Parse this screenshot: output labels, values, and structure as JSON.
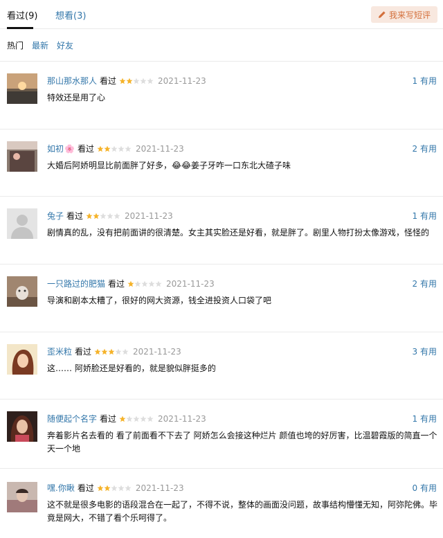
{
  "tabs": [
    {
      "label": "看过(9)",
      "active": true
    },
    {
      "label": "想看(3)",
      "active": false
    }
  ],
  "write_button": {
    "label": "我来写短评",
    "icon": "pencil-icon"
  },
  "filters": [
    {
      "label": "热门",
      "active": true
    },
    {
      "label": "最新",
      "active": false
    },
    {
      "label": "好友",
      "active": false
    }
  ],
  "seen_label": "看过",
  "colors": {
    "link": "#3377aa",
    "star": "#f5b32a",
    "star_empty": "#dddddd",
    "date": "#999999",
    "button_bg": "#f8e8df",
    "button_text": "#d36f3b"
  },
  "reviews": [
    {
      "user": "那山那水那人",
      "emoji": "",
      "rating": 2,
      "date": "2021-11-23",
      "useful": "1 有用",
      "content": "特效还是用了心"
    },
    {
      "user": "如初",
      "emoji": "🌸",
      "rating": 2,
      "date": "2021-11-23",
      "useful": "2 有用",
      "content": "大婚后阿娇明显比前面胖了好多，😂😂姜子牙咋一口东北大碴子味"
    },
    {
      "user": "兔子",
      "emoji": "",
      "rating": 2,
      "date": "2021-11-23",
      "useful": "1 有用",
      "content": "剧情真的乱，没有把前面讲的很清楚。女主其实脸还是好看，就是胖了。剧里人物打扮太像游戏，怪怪的"
    },
    {
      "user": "一只路过的肥猫",
      "emoji": "",
      "rating": 1,
      "date": "2021-11-23",
      "useful": "2 有用",
      "content": "导演和剧本太糟了，很好的网大资源，钱全进投资人口袋了吧"
    },
    {
      "user": "歪米粒",
      "emoji": "",
      "rating": 3,
      "date": "2021-11-23",
      "useful": "3 有用",
      "content": "这…… 阿娇脸还是好看的，就是貌似胖挺多的"
    },
    {
      "user": "随便起个名字",
      "emoji": "",
      "rating": 1,
      "date": "2021-11-23",
      "useful": "1 有用",
      "content": "奔着影片名去看的 看了前面看不下去了 阿娇怎么会接这种烂片 颜值也垮的好厉害，比温碧霞版的简直一个天一个地"
    },
    {
      "user": "嘿.你瞅",
      "emoji": "",
      "rating": 2,
      "date": "2021-11-23",
      "useful": "0 有用",
      "content": "这不就是很多电影的语段混合在一起了，不得不说，整体的画面没问题，故事结构懵懂无知，阿弥陀佛。毕竟是网大，不错了看个乐呵得了。"
    }
  ]
}
